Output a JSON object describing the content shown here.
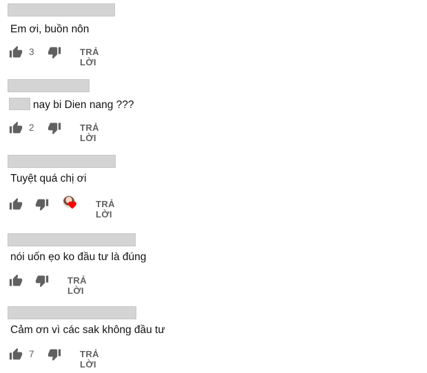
{
  "colors": {
    "redaction": "#d4d4d4",
    "icon": "#606060",
    "heart": "#ff0000"
  },
  "comments": [
    {
      "text": "Em ơi, buồn nôn",
      "likes": "3",
      "reply": "TRẢ LỜI"
    },
    {
      "text": "nay bi Dien nang ???",
      "likes": "2",
      "reply": "TRẢ LỜI"
    },
    {
      "text": "Tuyệt quá chị ơi",
      "likes": "",
      "reply": "TRẢ LỜI"
    },
    {
      "text": "nói uốn ẹo ko đầu tư là đúng",
      "likes": "",
      "reply": "TRẢ LỜI"
    },
    {
      "text": "Cảm ơn vì các sak không đầu tư",
      "likes": "7",
      "reply": "TRẢ LỜI"
    }
  ]
}
